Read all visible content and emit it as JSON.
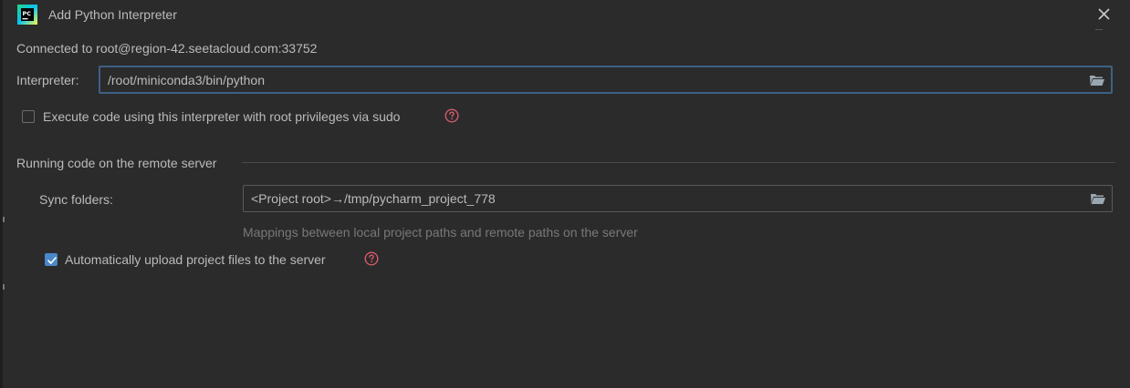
{
  "dialog": {
    "title": "Add Python Interpreter",
    "logo_text": "PC"
  },
  "connection": {
    "text": "Connected to root@region-42.seetacloud.com:33752"
  },
  "interpreter": {
    "label": "Interpreter:",
    "value": "/root/miniconda3/bin/python"
  },
  "sudo_option": {
    "label": "Execute code using this interpreter with root privileges via sudo",
    "checked": false
  },
  "remote_section": {
    "title": "Running code on the remote server",
    "sync_label": "Sync folders:",
    "sync_value": "<Project root>→/tmp/pycharm_project_778",
    "hint": "Mappings between local project paths and remote paths on the server",
    "auto_upload": {
      "label": "Automatically upload project files to the server",
      "checked": true
    }
  },
  "colors": {
    "background": "#2b2b2b",
    "focus_border": "#3d6185",
    "checkbox_checked": "#4a88c7",
    "help_icon": "#d75b6b",
    "hint_text": "#787878"
  },
  "icons": {
    "logo": "pycharm-logo-icon",
    "close": "close-icon",
    "folder": "folder-open-icon",
    "help": "help-icon",
    "check": "checkmark-icon"
  }
}
